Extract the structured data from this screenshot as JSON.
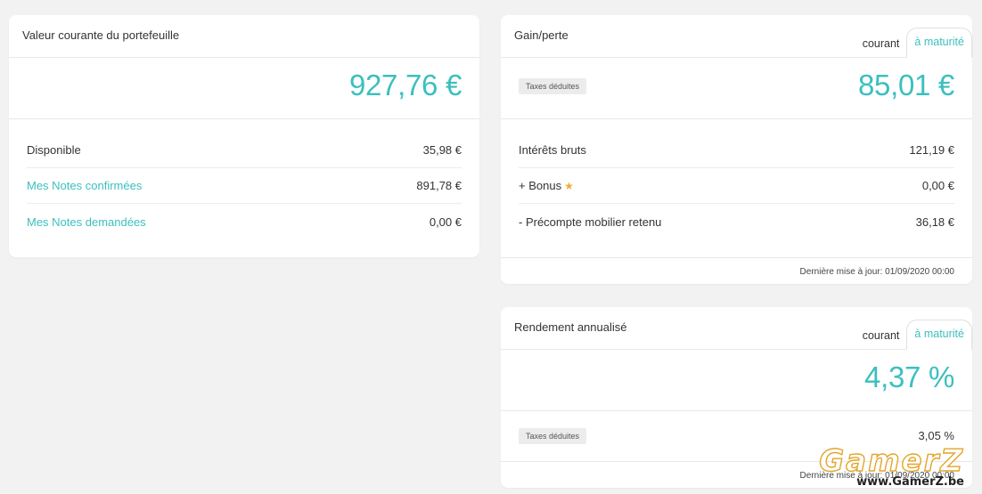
{
  "portfolio": {
    "title": "Valeur courante du portefeuille",
    "total": "927,76 €",
    "rows": [
      {
        "label": "Disponible",
        "value": "35,98 €"
      },
      {
        "label": "Mes Notes confirmées",
        "value": "891,78 €"
      },
      {
        "label": "Mes Notes demandées",
        "value": "0,00 €"
      }
    ]
  },
  "gain": {
    "title": "Gain/perte",
    "tabs": [
      "courant",
      "à maturité"
    ],
    "badge": "Taxes déduites",
    "total": "85,01 €",
    "rows": [
      {
        "label": "Intérêts bruts",
        "value": "121,19 €"
      },
      {
        "label": "+ Bonus",
        "value": "0,00 €"
      },
      {
        "label": "- Précompte mobilier retenu",
        "value": "36,18 €"
      }
    ],
    "updated": "Dernière mise à jour: 01/09/2020 00:00"
  },
  "yield": {
    "title": "Rendement annualisé",
    "tabs": [
      "courant",
      "à maturité"
    ],
    "total": "4,37 %",
    "badge": "Taxes déduites",
    "net": "3,05 %",
    "updated": "Dernière mise à jour: 01/09/2020 00:00"
  },
  "watermark": {
    "logo": "GamerZ",
    "url": "www.GamerZ.be"
  },
  "colors": {
    "accent": "#3cbfbf",
    "star": "#f2a93b",
    "background": "#f2f2f2"
  }
}
